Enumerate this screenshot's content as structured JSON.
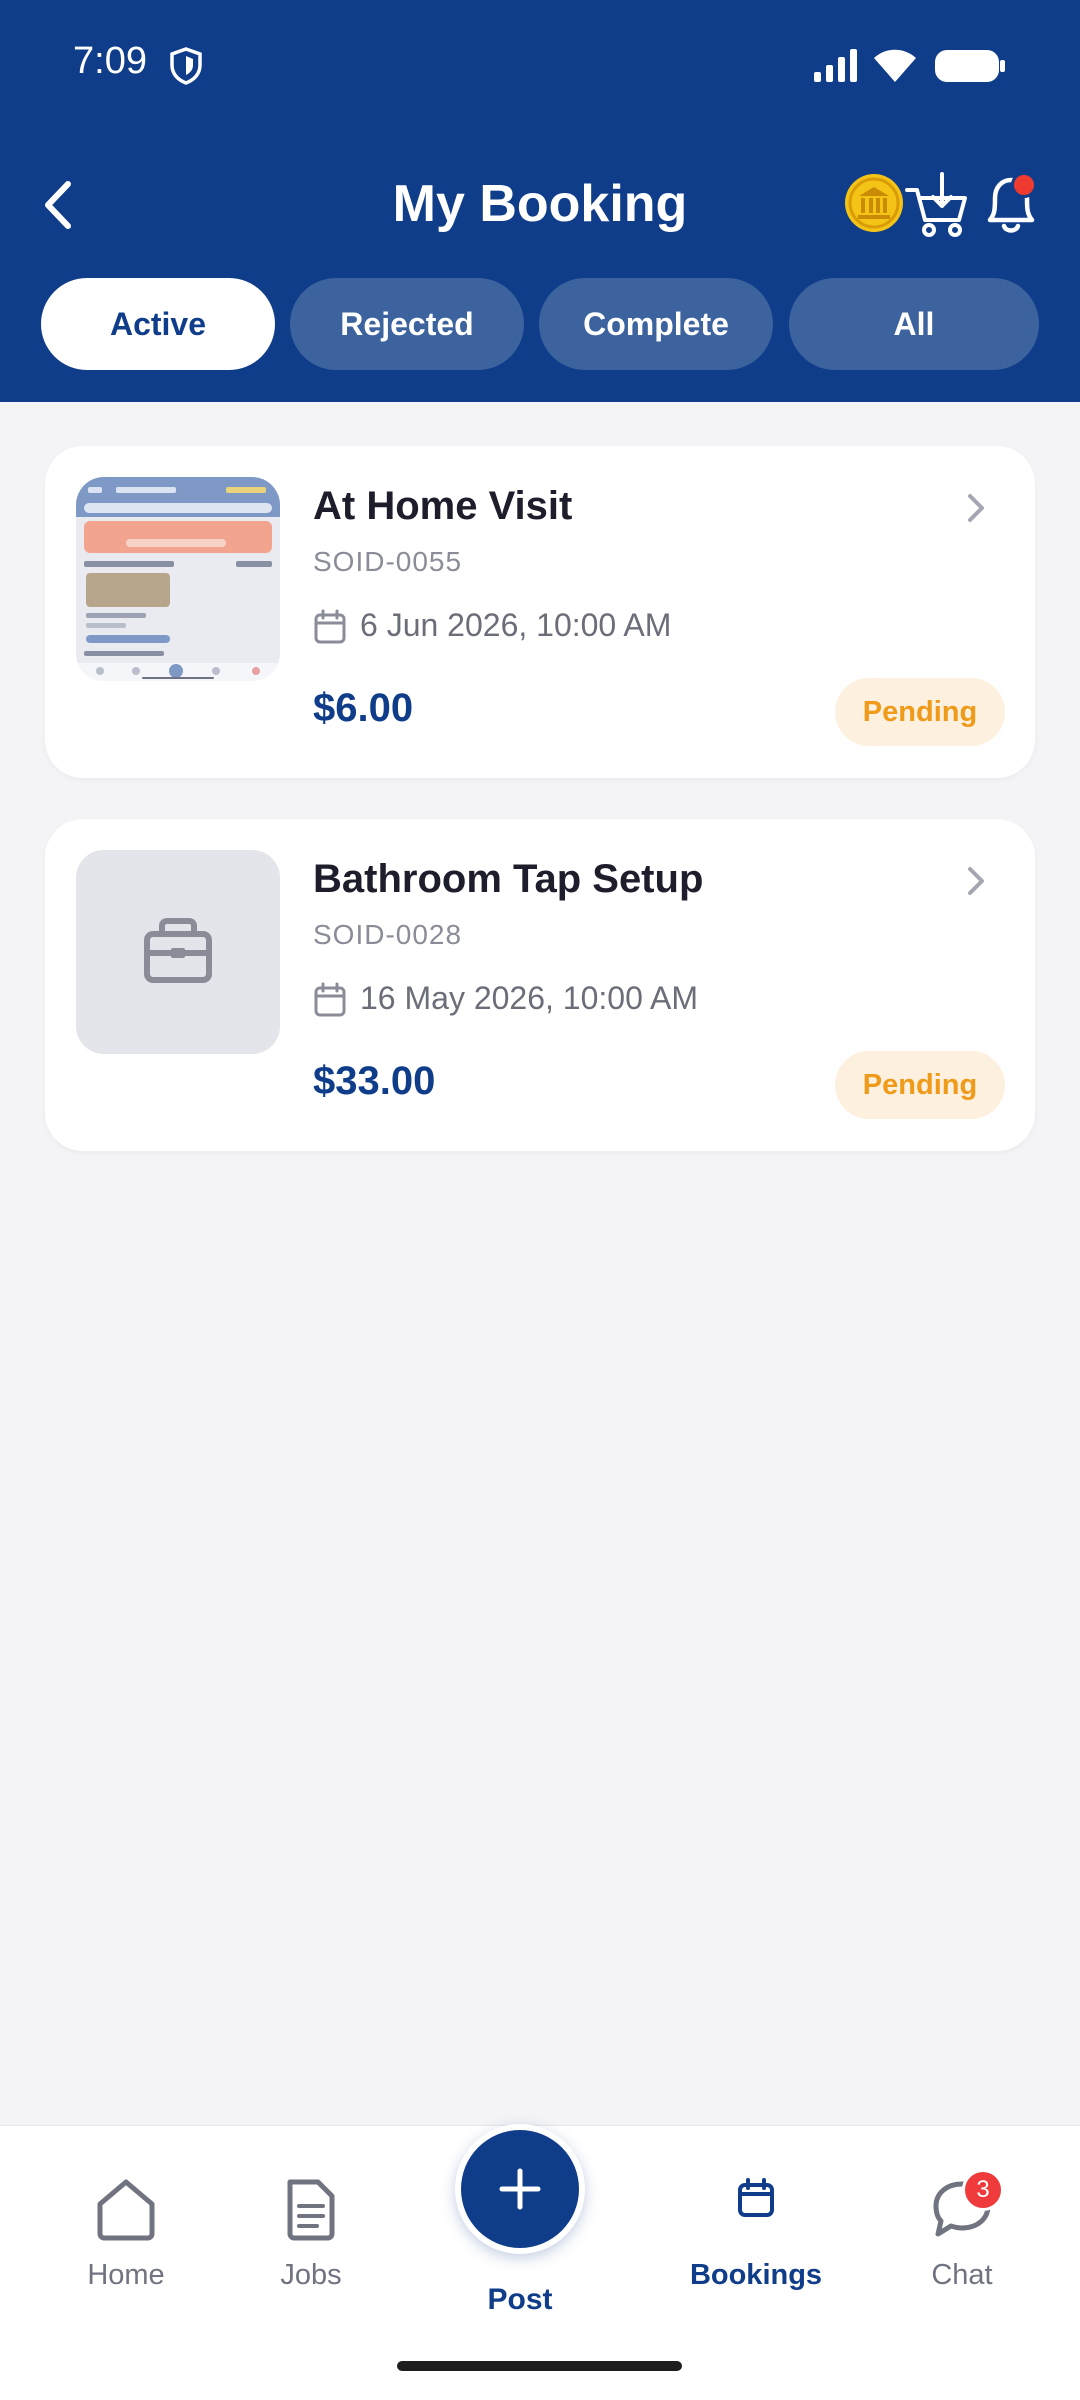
{
  "status_bar": {
    "time": "7:09"
  },
  "header": {
    "title": "My Booking",
    "back_icon": "back-arrow-icon",
    "action_icons": [
      "bank-coin-icon",
      "cart-download-icon",
      "bell-icon"
    ],
    "notification_dot_color": "#ef3b2f"
  },
  "tabs": [
    {
      "label": "Active",
      "active": true
    },
    {
      "label": "Rejected",
      "active": false
    },
    {
      "label": "Complete",
      "active": false
    },
    {
      "label": "All",
      "active": false
    }
  ],
  "bookings": [
    {
      "title": "At Home Visit",
      "id": "SOID-0055",
      "date": "6 Jun 2026, 10:00 AM",
      "price": "$6.00",
      "status": "Pending",
      "thumbnail": "app-screenshot-image"
    },
    {
      "title": "Bathroom Tap Setup",
      "id": "SOID-0028",
      "date": "16 May 2026, 10:00 AM",
      "price": "$33.00",
      "status": "Pending",
      "thumbnail": "toolbox-icon"
    }
  ],
  "bottom_nav": {
    "items": [
      {
        "label": "Home",
        "icon": "home-icon",
        "active": false
      },
      {
        "label": "Jobs",
        "icon": "document-icon",
        "active": false
      },
      {
        "label": "Post",
        "icon": "plus-icon",
        "active": false
      },
      {
        "label": "Bookings",
        "icon": "calendar-icon",
        "active": true
      },
      {
        "label": "Chat",
        "icon": "chat-bubble-icon",
        "active": false,
        "badge": "3"
      }
    ]
  },
  "colors": {
    "primary": "#0f3d8a",
    "tab_inactive": "#3d639f",
    "background": "#f4f4f6",
    "pending_text": "#f09a19",
    "pending_bg": "#fdf0df",
    "badge_red": "#ef3b3b"
  }
}
